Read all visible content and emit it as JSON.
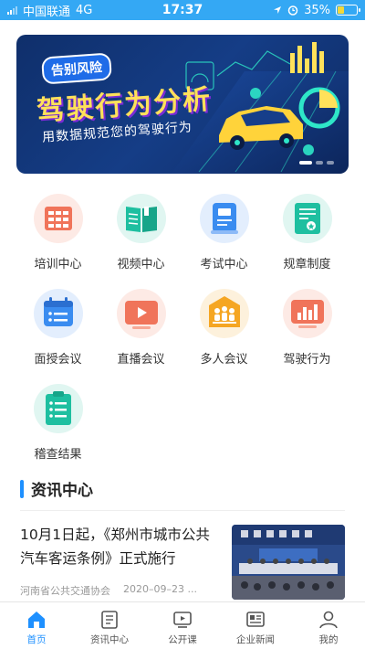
{
  "status_bar": {
    "carrier": "中国联通",
    "network": "4G",
    "time": "17:37",
    "battery_text": "35%",
    "battery_level": 0.35
  },
  "banner": {
    "tag": "告别风险",
    "title": "驾驶行为分析",
    "subtitle": "用数据规范您的驾驶行为"
  },
  "menu": [
    {
      "label": "培训中心",
      "icon": "training-center-icon",
      "color": "#f0745a",
      "bg": "#fdeae5"
    },
    {
      "label": "视频中心",
      "icon": "video-center-icon",
      "color": "#1ebfa0",
      "bg": "#e0f6f1"
    },
    {
      "label": "考试中心",
      "icon": "exam-center-icon",
      "color": "#3a8cf0",
      "bg": "#e3eefd"
    },
    {
      "label": "规章制度",
      "icon": "regulations-icon",
      "color": "#1ebfa0",
      "bg": "#e0f6f1"
    },
    {
      "label": "面授会议",
      "icon": "face-meeting-icon",
      "color": "#3a8cf0",
      "bg": "#e3eefd"
    },
    {
      "label": "直播会议",
      "icon": "live-meeting-icon",
      "color": "#f0745a",
      "bg": "#fdeae5"
    },
    {
      "label": "多人会议",
      "icon": "multi-meeting-icon",
      "color": "#f5a623",
      "bg": "#fdf1dc"
    },
    {
      "label": "驾驶行为",
      "icon": "driving-behavior-icon",
      "color": "#f0745a",
      "bg": "#fdeae5"
    },
    {
      "label": "稽查结果",
      "icon": "inspection-result-icon",
      "color": "#1ebfa0",
      "bg": "#e0f6f1"
    }
  ],
  "section": {
    "title": "资讯中心"
  },
  "news": [
    {
      "title": "10月1日起，《郑州市城市公共汽车客运条例》正式施行",
      "source": "河南省公共交通协会",
      "date": "2020–09–23 ..."
    }
  ],
  "tabs": [
    {
      "label": "首页",
      "icon": "home-icon",
      "active": true
    },
    {
      "label": "资讯中心",
      "icon": "news-center-icon",
      "active": false
    },
    {
      "label": "公开课",
      "icon": "open-class-icon",
      "active": false
    },
    {
      "label": "企业新闻",
      "icon": "company-news-icon",
      "active": false
    },
    {
      "label": "我的",
      "icon": "profile-icon",
      "active": false
    }
  ],
  "colors": {
    "accent": "#1e90ff",
    "status_bar": "#34a8f4"
  }
}
